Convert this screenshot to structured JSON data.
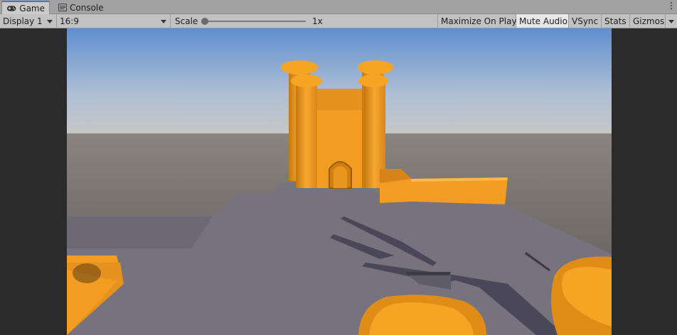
{
  "tabs": [
    {
      "label": "Game",
      "icon": "gamepad-icon",
      "active": true
    },
    {
      "label": "Console",
      "icon": "console-icon",
      "active": false
    }
  ],
  "toolbar": {
    "display": "Display 1",
    "aspect": "16:9",
    "scale_label": "Scale",
    "scale_value": "1x",
    "maximize": "Maximize On Play",
    "mute": "Mute Audio",
    "vsync": "VSync",
    "stats": "Stats",
    "gizmos": "Gizmos"
  },
  "colors": {
    "accent_tab": "#3a79d8",
    "sky_top": "#5f8fd0",
    "horizon": "#c7c7c7",
    "ground": "#77737a",
    "castle": "#f29d22"
  }
}
